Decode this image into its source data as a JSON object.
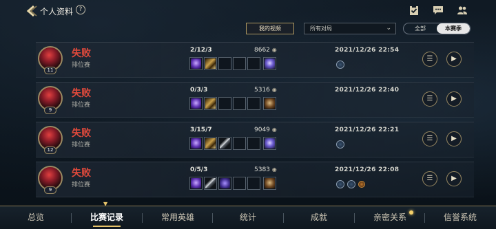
{
  "header": {
    "title": "个人资料",
    "help": "?"
  },
  "filters": {
    "my_videos": "我的视频",
    "match_select": "所有对局",
    "scope_options": [
      "全部",
      "本赛季"
    ],
    "scope_selected": "本赛季"
  },
  "matches": [
    {
      "result": "失败",
      "mode": "排位赛",
      "level": "11",
      "kda": "2/12/3",
      "gold": "8662",
      "time": "2021/12/26 22:54",
      "items": [
        "purple-item-icon",
        "gold-item-icon",
        "",
        "",
        "",
        "ward-icon"
      ],
      "badges": [
        "blue"
      ]
    },
    {
      "result": "失败",
      "mode": "排位赛",
      "level": "9",
      "kda": "0/3/3",
      "gold": "5316",
      "time": "2021/12/26 22:40",
      "items": [
        "purple-item-icon",
        "gold-item-icon",
        "",
        "",
        "",
        "brown-trinket-icon"
      ],
      "badges": []
    },
    {
      "result": "失败",
      "mode": "排位赛",
      "level": "12",
      "kda": "3/15/7",
      "gold": "9049",
      "time": "2021/12/26 22:21",
      "items": [
        "purple-item-icon",
        "gold-item-icon",
        "blade-item-icon",
        "",
        "",
        "ward-icon"
      ],
      "badges": [
        "blue"
      ]
    },
    {
      "result": "失败",
      "mode": "排位赛",
      "level": "9",
      "kda": "0/5/3",
      "gold": "5383",
      "time": "2021/12/26 22:08",
      "items": [
        "purple-item-icon",
        "blade-item-icon",
        "violet-item-icon",
        "",
        "",
        "brown-trinket-icon"
      ],
      "badges": [
        "blue",
        "blue",
        "orange"
      ]
    }
  ],
  "tabs": [
    "总览",
    "比赛记录",
    "常用英雄",
    "统计",
    "成就",
    "亲密关系",
    "信誉系统"
  ],
  "active_tab": "比赛记录"
}
